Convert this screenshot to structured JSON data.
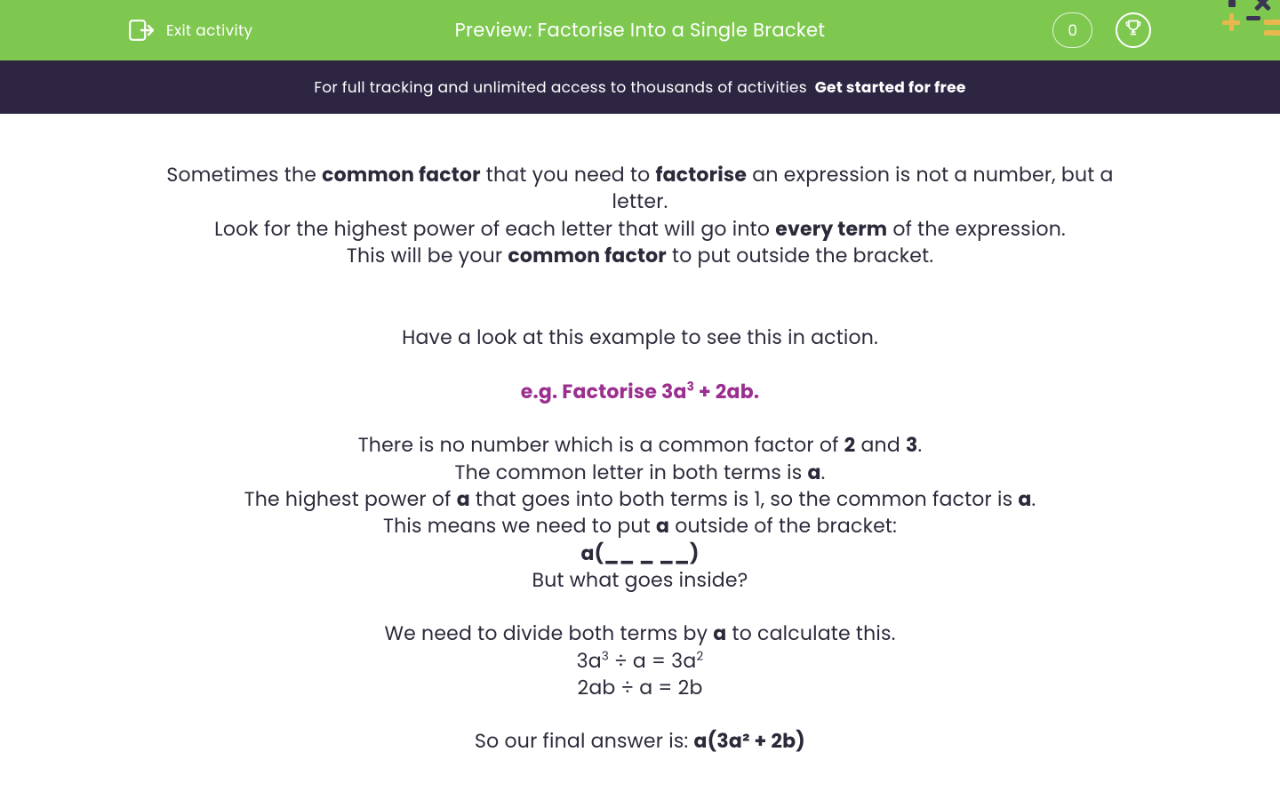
{
  "header": {
    "exit_label": "Exit activity",
    "title": "Preview: Factorise Into a Single Bracket",
    "score": "0"
  },
  "banner": {
    "text": "For full tracking and unlimited access to thousands of activities",
    "cta": "Get started for free"
  },
  "content": {
    "p1_a": "Sometimes the ",
    "p1_b": "common factor",
    "p1_c": " that you need to ",
    "p1_d": "factorise",
    "p1_e": " an expression is not a number, but a letter.",
    "p2_a": "Look for the highest power of each letter that will go into ",
    "p2_b": "every term",
    "p2_c": " of the expression.",
    "p3_a": "This will be your ",
    "p3_b": "common factor",
    "p3_c": " to put outside the bracket.",
    "p4": "Have a look at this example to see this in action.",
    "ex_a": "e.g. Factorise 3a",
    "ex_sup": "3",
    "ex_b": " + 2ab.",
    "p5_a": "There is no number which is a common factor of ",
    "p5_b": "2",
    "p5_c": " and ",
    "p5_d": "3",
    "p5_e": ".",
    "p6_a": "The common letter in both terms is ",
    "p6_b": "a",
    "p6_c": ".",
    "p7_a": "The highest power of ",
    "p7_b": "a",
    "p7_c": " that goes into both terms is 1, so the common factor is ",
    "p7_d": "a",
    "p7_e": ".",
    "p8_a": "This means we need to put ",
    "p8_b": "a",
    "p8_c": " outside of the bracket:",
    "p9": "a(__ _ __)",
    "p10": "But what goes inside?",
    "p11_a": "We need to divide both terms by ",
    "p11_b": "a",
    "p11_c": " to calculate this. ",
    "p12_a": "3a",
    "p12_sup1": "3",
    "p12_b": " ÷ a = 3a",
    "p12_sup2": "2",
    "p13": "2ab ÷ a = 2b",
    "p14_a": "So our final answer is: ",
    "p14_b": "a(3a² + 2b)"
  }
}
